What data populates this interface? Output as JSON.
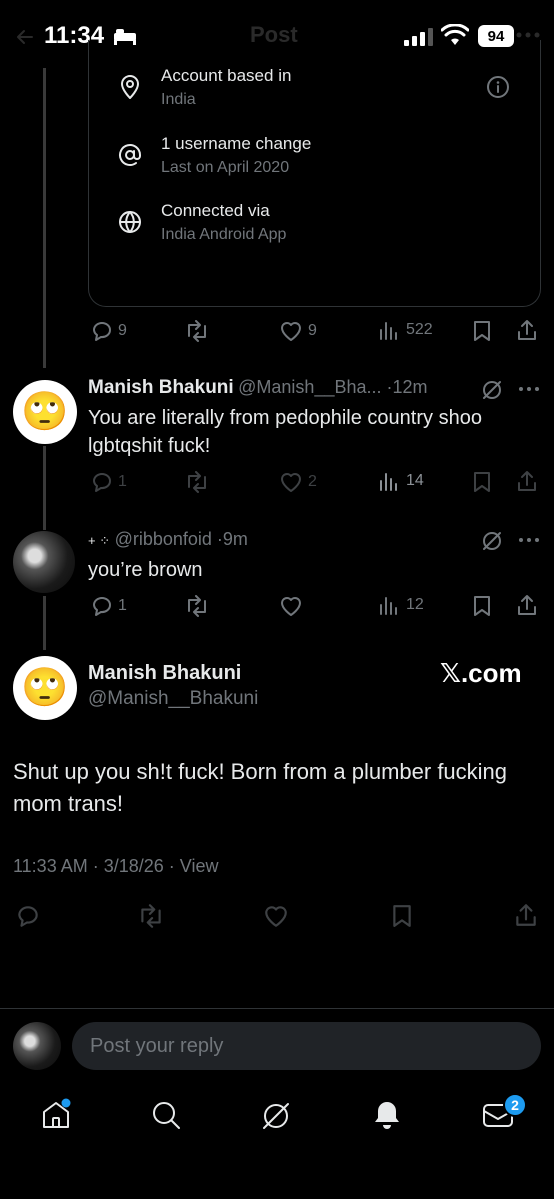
{
  "status_bar": {
    "time": "11:34",
    "battery": "94"
  },
  "header": {
    "title": "Post"
  },
  "about": {
    "rows": [
      {
        "title": "Account based in",
        "sub": "India"
      },
      {
        "title": "1 username change",
        "sub": "Last on April 2020"
      },
      {
        "title": "Connected via",
        "sub": "India Android App"
      }
    ]
  },
  "post1_actions": {
    "replies": "9",
    "likes": "9",
    "views": "522"
  },
  "reply1": {
    "name": "Manish Bhakuni",
    "handle": "@Manish__Bha... ·",
    "time": "12m",
    "text": "You are literally from pedophile country shoo lgbtqshit fuck!",
    "replies": "1",
    "likes": "2",
    "views": "14",
    "avatar_emoji": "🙄"
  },
  "reply2": {
    "name_prefix": "+ ⁘",
    "handle": "@ribbonfoid ·",
    "time": "9m",
    "text": "you’re brown",
    "replies": "1",
    "views": "12"
  },
  "main_post": {
    "name": "Manish Bhakuni",
    "handle": "@Manish__Bhakuni",
    "source": "𝕏.com",
    "text": "Shut up you sh!t fuck! Born from a plumber fucking mom trans!",
    "meta": "11:33 AM · 3/18/26 · View",
    "avatar_emoji": "🙄"
  },
  "composer": {
    "placeholder": "Post your reply"
  },
  "tabbar": {
    "messages_badge": "2"
  }
}
